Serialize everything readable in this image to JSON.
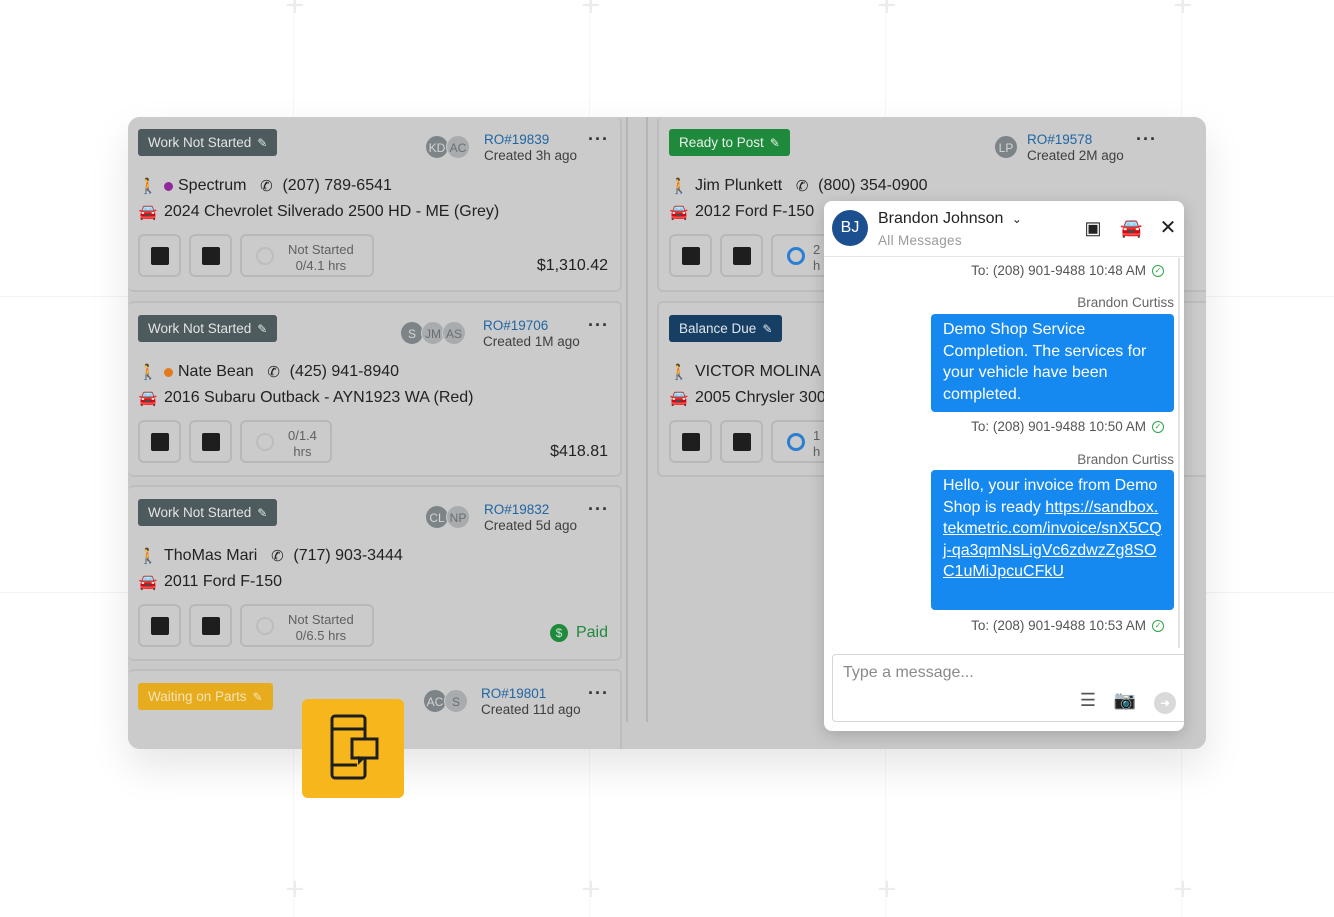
{
  "colors": {
    "accent_blue": "#1689f0",
    "brand_yellow": "#f6b61c",
    "status_gray": "#4d5a5e",
    "status_green": "#1f8a3c",
    "status_navy": "#173e63",
    "status_yellow": "#e6ac1e"
  },
  "left_cards": [
    {
      "status": "Work Not Started",
      "avatars": [
        "KD",
        "AC"
      ],
      "ro": "RO#19839",
      "created": "Created 3h ago",
      "customer": "Spectrum",
      "customer_dot": "#8e2a9c",
      "phone": "(207) 789-6541",
      "vehicle": "2024 Chevrolet Silverado 2500 HD - ME (Grey)",
      "progress_line1": "Not Started",
      "progress_line2": "0/4.1 hrs",
      "amount": "$1,310.42"
    },
    {
      "status": "Work Not Started",
      "avatars": [
        "S",
        "JM",
        "AS"
      ],
      "ro": "RO#19706",
      "created": "Created 1M ago",
      "customer": "Nate Bean",
      "customer_dot": "#e27a1f",
      "phone": "(425) 941-8940",
      "vehicle": "2016 Subaru Outback - AYN1923 WA (Red)",
      "progress_line1": "0/1.4",
      "progress_line2": "hrs",
      "amount": "$418.81"
    },
    {
      "status": "Work Not Started",
      "avatars": [
        "CL",
        "NP"
      ],
      "ro": "RO#19832",
      "created": "Created 5d ago",
      "customer": "ThoMas Mari",
      "phone": "(717) 903-3444",
      "vehicle": "2011 Ford F-150",
      "progress_line1": "Not Started",
      "progress_line2": "0/6.5 hrs",
      "paid_label": "Paid"
    },
    {
      "status": "Waiting on Parts",
      "avatars": [
        "AC",
        "S"
      ],
      "ro": "RO#19801",
      "created": "Created 11d ago"
    }
  ],
  "right_cards": [
    {
      "status": "Ready to Post",
      "avatars": [
        "LP"
      ],
      "ro": "RO#19578",
      "created": "Created 2M ago",
      "customer": "Jim Plunkett",
      "phone": "(800) 354-0900",
      "vehicle": "2012 Ford F-150",
      "progress_line1": "2",
      "progress_line2": "h"
    },
    {
      "status": "Balance Due",
      "customer": "VICTOR MOLINA",
      "vehicle": "2005 Chrysler 300",
      "progress_line1": "1",
      "progress_line2": "h"
    }
  ],
  "chat": {
    "initials": "BJ",
    "contact_name": "Brandon Johnson",
    "subtitle": "All Messages",
    "icons": [
      "calendar-icon",
      "car-icon",
      "close-icon"
    ],
    "messages": [
      {
        "meta": "To: (208) 901-9488   10:48 AM"
      },
      {
        "sender": "Brandon Curtiss",
        "text": "Demo Shop Service Completion. The services for your vehicle have been completed.",
        "meta": "To: (208) 901-9488   10:50 AM"
      },
      {
        "sender": "Brandon Curtiss",
        "text": "Hello, your invoice from Demo Shop is ready",
        "link": "https://sandbox.tekmetric.com/invoice/snX5CQj-qa3qmNsLigVc6zdwzZg8SOC1uMiJpcuCFkU",
        "meta": "To: (208) 901-9488   10:53 AM"
      }
    ],
    "input_placeholder": "Type a message..."
  }
}
